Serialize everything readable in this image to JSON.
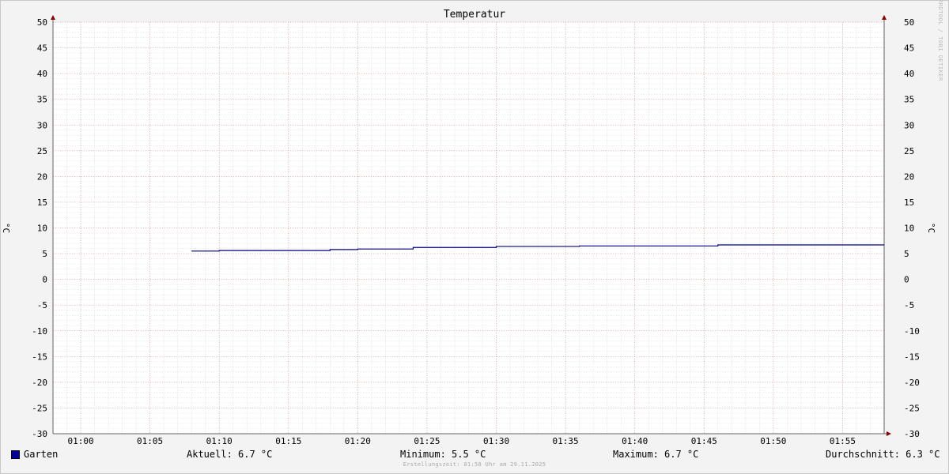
{
  "chart_data": {
    "type": "line",
    "title": "Temperatur",
    "ylabel": "°C",
    "ylim": [
      -30,
      50
    ],
    "yticks": [
      50,
      45,
      40,
      35,
      30,
      25,
      20,
      15,
      10,
      5,
      0,
      -5,
      -10,
      -15,
      -20,
      -25,
      -30
    ],
    "xlim": [
      "00:58",
      "01:58"
    ],
    "xticks": [
      "01:00",
      "01:05",
      "01:10",
      "01:15",
      "01:20",
      "01:25",
      "01:30",
      "01:35",
      "01:40",
      "01:45",
      "01:50",
      "01:55"
    ],
    "grid": true,
    "series": [
      {
        "name": "Garten",
        "color": "#000080",
        "x": [
          "01:08",
          "01:10",
          "01:18",
          "01:20",
          "01:24",
          "01:30",
          "01:36",
          "01:46",
          "01:58"
        ],
        "values": [
          5.5,
          5.6,
          5.8,
          5.9,
          6.2,
          6.4,
          6.5,
          6.7,
          6.7
        ]
      }
    ]
  },
  "legend": {
    "series_name": "Garten",
    "swatch_color": "#0000a0",
    "current": "Aktuell: 6.7 °C",
    "minimum": "Minimum: 5.5 °C",
    "maximum": "Maximum: 6.7 °C",
    "average": "Durchschnitt: 6.3 °C"
  },
  "watermark": "RRDTOOL / TOBI OETIKER",
  "footer": "Erstellungszeit: 01:58 Uhr am 29.11.2025"
}
